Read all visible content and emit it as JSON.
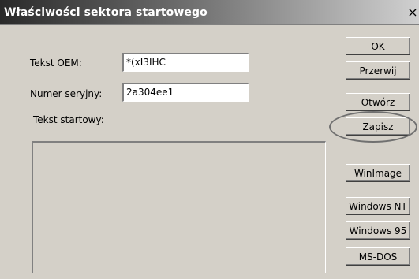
{
  "window": {
    "title": "Właściwości sektora startowego",
    "close_glyph": "×"
  },
  "fields": {
    "oem_label": "Tekst OEM:",
    "oem_value": "*(xI3IHC",
    "serial_label": "Numer seryjny:",
    "serial_value": "2a304ee1",
    "boot_text_label": "Tekst startowy:",
    "boot_text_value": ""
  },
  "buttons": {
    "ok": "OK",
    "cancel": "Przerwij",
    "open": "Otwórz",
    "save": "Zapisz",
    "winimage": "WinImage",
    "windows_nt": "Windows NT",
    "windows_95": "Windows 95",
    "ms_dos": "MS-DOS"
  },
  "annotation": {
    "highlighted_button": "save",
    "highlight_color": "#707070"
  }
}
